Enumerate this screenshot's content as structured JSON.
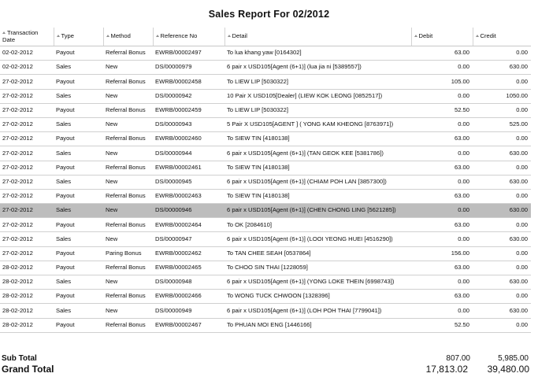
{
  "report": {
    "title": "Sales Report For 02/2012",
    "columns": [
      "Transaction Date",
      "Type",
      "Method",
      "Reference No",
      "Detail",
      "Debit",
      "Credit"
    ],
    "rows": [
      [
        "02-02-2012",
        "Payout",
        "Referral Bonus",
        "EWRB/00002497",
        "To lua khang yaw [0164302]",
        "63.00",
        "0.00"
      ],
      [
        "02-02-2012",
        "Sales",
        "New",
        "DS/00000979",
        "6 pair x USD105[Agent (6+1)] (lua jia ni [5389557])",
        "0.00",
        "630.00"
      ],
      [
        "27-02-2012",
        "Payout",
        "Referral Bonus",
        "EWRB/00002458",
        "To LIEW LIP [5030322]",
        "105.00",
        "0.00"
      ],
      [
        "27-02-2012",
        "Sales",
        "New",
        "DS/00000942",
        "10 Pair X USD105[Dealer] (LIEW KOK LEONG [0852517])",
        "0.00",
        "1050.00"
      ],
      [
        "27-02-2012",
        "Payout",
        "Referral Bonus",
        "EWRB/00002459",
        "To LIEW LIP [5030322]",
        "52.50",
        "0.00"
      ],
      [
        "27-02-2012",
        "Sales",
        "New",
        "DS/00000943",
        "5 Pair X USD105[AGENT ] ( YONG KAM KHEONG [8763971])",
        "0.00",
        "525.00"
      ],
      [
        "27-02-2012",
        "Payout",
        "Referral Bonus",
        "EWRB/00002460",
        "To SIEW TIN [4180138]",
        "63.00",
        "0.00"
      ],
      [
        "27-02-2012",
        "Sales",
        "New",
        "DS/00000944",
        "6 pair x USD105[Agent (6+1)] (TAN GEOK KEE [5381786])",
        "0.00",
        "630.00"
      ],
      [
        "27-02-2012",
        "Payout",
        "Referral Bonus",
        "EWRB/00002461",
        "To SIEW TIN [4180138]",
        "63.00",
        "0.00"
      ],
      [
        "27-02-2012",
        "Sales",
        "New",
        "DS/00000945",
        "6 pair x USD105[Agent (6+1)] (CHIAM POH LAN [3857300])",
        "0.00",
        "630.00"
      ],
      [
        "27-02-2012",
        "Payout",
        "Referral Bonus",
        "EWRB/00002463",
        "To SIEW TIN [4180138]",
        "63.00",
        "0.00"
      ],
      [
        "27-02-2012",
        "Sales",
        "New",
        "DS/00000946",
        "6 pair x USD105[Agent (6+1)] (CHEN CHONG LING [5621285])",
        "0.00",
        "630.00"
      ],
      [
        "27-02-2012",
        "Payout",
        "Referral Bonus",
        "EWRB/00002464",
        "To OK [2084610]",
        "63.00",
        "0.00"
      ],
      [
        "27-02-2012",
        "Sales",
        "New",
        "DS/00000947",
        "6 pair x USD105[Agent (6+1)] (LOOI YEONG HUEI [4516290])",
        "0.00",
        "630.00"
      ],
      [
        "27-02-2012",
        "Payout",
        "Paring Bonus",
        "EWRB/00002462",
        "To TAN CHEE SEAH [0537864]",
        "156.00",
        "0.00"
      ],
      [
        "28-02-2012",
        "Payout",
        "Referral Bonus",
        "EWRB/00002465",
        "To CHOO SIN THAI [1228059]",
        "63.00",
        "0.00"
      ],
      [
        "28-02-2012",
        "Sales",
        "New",
        "DS/00000948",
        "6 pair x USD105[Agent (6+1)] (YONG LOKE THEIN [6998743])",
        "0.00",
        "630.00"
      ],
      [
        "28-02-2012",
        "Payout",
        "Referral Bonus",
        "EWRB/00002466",
        "To WONG TUCK CHWOON [1328396]",
        "63.00",
        "0.00"
      ],
      [
        "28-02-2012",
        "Sales",
        "New",
        "DS/00000949",
        "6 pair x USD105[Agent (6+1)] (LOH POH THAI [7799041])",
        "0.00",
        "630.00"
      ],
      [
        "28-02-2012",
        "Payout",
        "Referral Bonus",
        "EWRB/00002467",
        "To PHUAN MOI ENG [1446166]",
        "52.50",
        "0.00"
      ]
    ],
    "highlight_row_index": 11,
    "highlight_color": "#bdbdbd",
    "sub_total": {
      "label": "Sub Total",
      "debit": "807.00",
      "credit": "5,985.00"
    },
    "grand_total": {
      "label": "Grand Total",
      "debit": "17,813.02",
      "credit": "39,480.00"
    }
  }
}
